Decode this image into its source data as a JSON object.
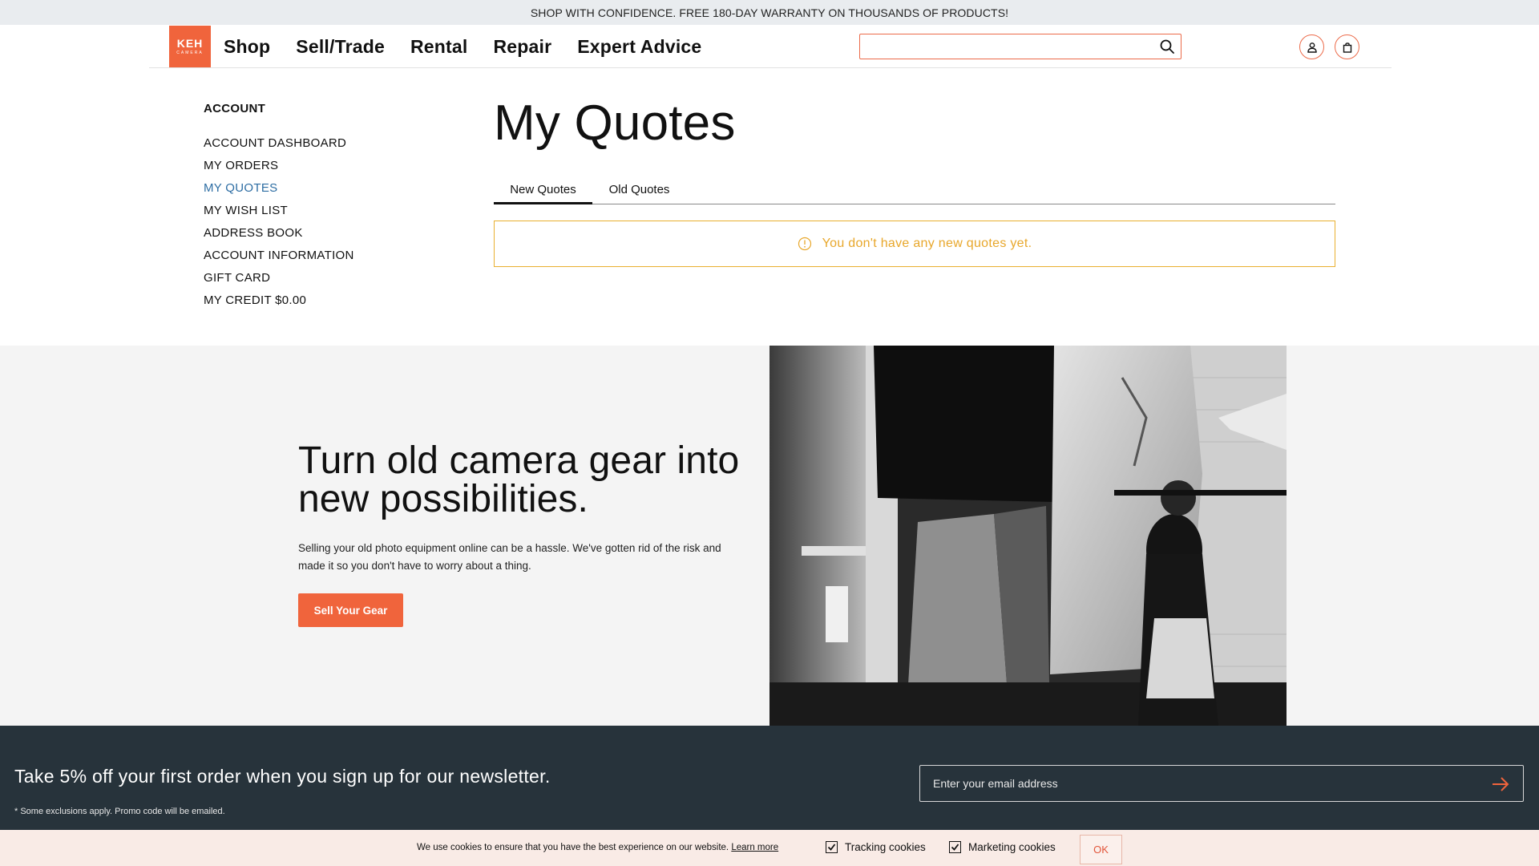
{
  "announcement": "SHOP WITH CONFIDENCE. FREE 180-DAY WARRANTY ON THOUSANDS OF PRODUCTS!",
  "logo": {
    "line1": "KEH",
    "line2": "CAMERA"
  },
  "nav": [
    "Shop",
    "Sell/Trade",
    "Rental",
    "Repair",
    "Expert Advice"
  ],
  "search": {
    "value": "",
    "placeholder": ""
  },
  "sidebar": {
    "title": "ACCOUNT",
    "items": [
      {
        "label": "ACCOUNT DASHBOARD"
      },
      {
        "label": "MY ORDERS"
      },
      {
        "label": "MY QUOTES",
        "active": true
      },
      {
        "label": "MY WISH LIST"
      },
      {
        "label": "ADDRESS BOOK"
      },
      {
        "label": "ACCOUNT INFORMATION"
      },
      {
        "label": "GIFT CARD"
      },
      {
        "label": "MY CREDIT $0.00"
      }
    ]
  },
  "main": {
    "title": "My Quotes",
    "tabs": [
      {
        "label": "New Quotes",
        "active": true
      },
      {
        "label": "Old Quotes",
        "active": false
      }
    ],
    "notice": "You don't have any new quotes yet."
  },
  "promo": {
    "headline": "Turn old camera gear into new possibilities.",
    "body": "Selling your old photo equipment online can be a hassle. We've gotten rid of the risk and made it so you don't have to worry about a thing.",
    "button": "Sell Your Gear"
  },
  "newsletter": {
    "headline": "Take 5% off your first order when you sign up for our newsletter.",
    "fine_print": "* Some exclusions apply. Promo code will be emailed.",
    "email_placeholder": "Enter your email address"
  },
  "cookie": {
    "message": "We use cookies to ensure that you have the best experience on our website.",
    "learn_more": "Learn more",
    "tracking": {
      "label": "Tracking cookies",
      "checked": true
    },
    "marketing": {
      "label": "Marketing cookies",
      "checked": true
    },
    "ok": "OK"
  },
  "colors": {
    "brand": "#f0643c",
    "active_link": "#2d6da3",
    "notice": "#e8a72b",
    "footer_bg": "#27333b",
    "cookie_bg": "#f9ebe6"
  }
}
